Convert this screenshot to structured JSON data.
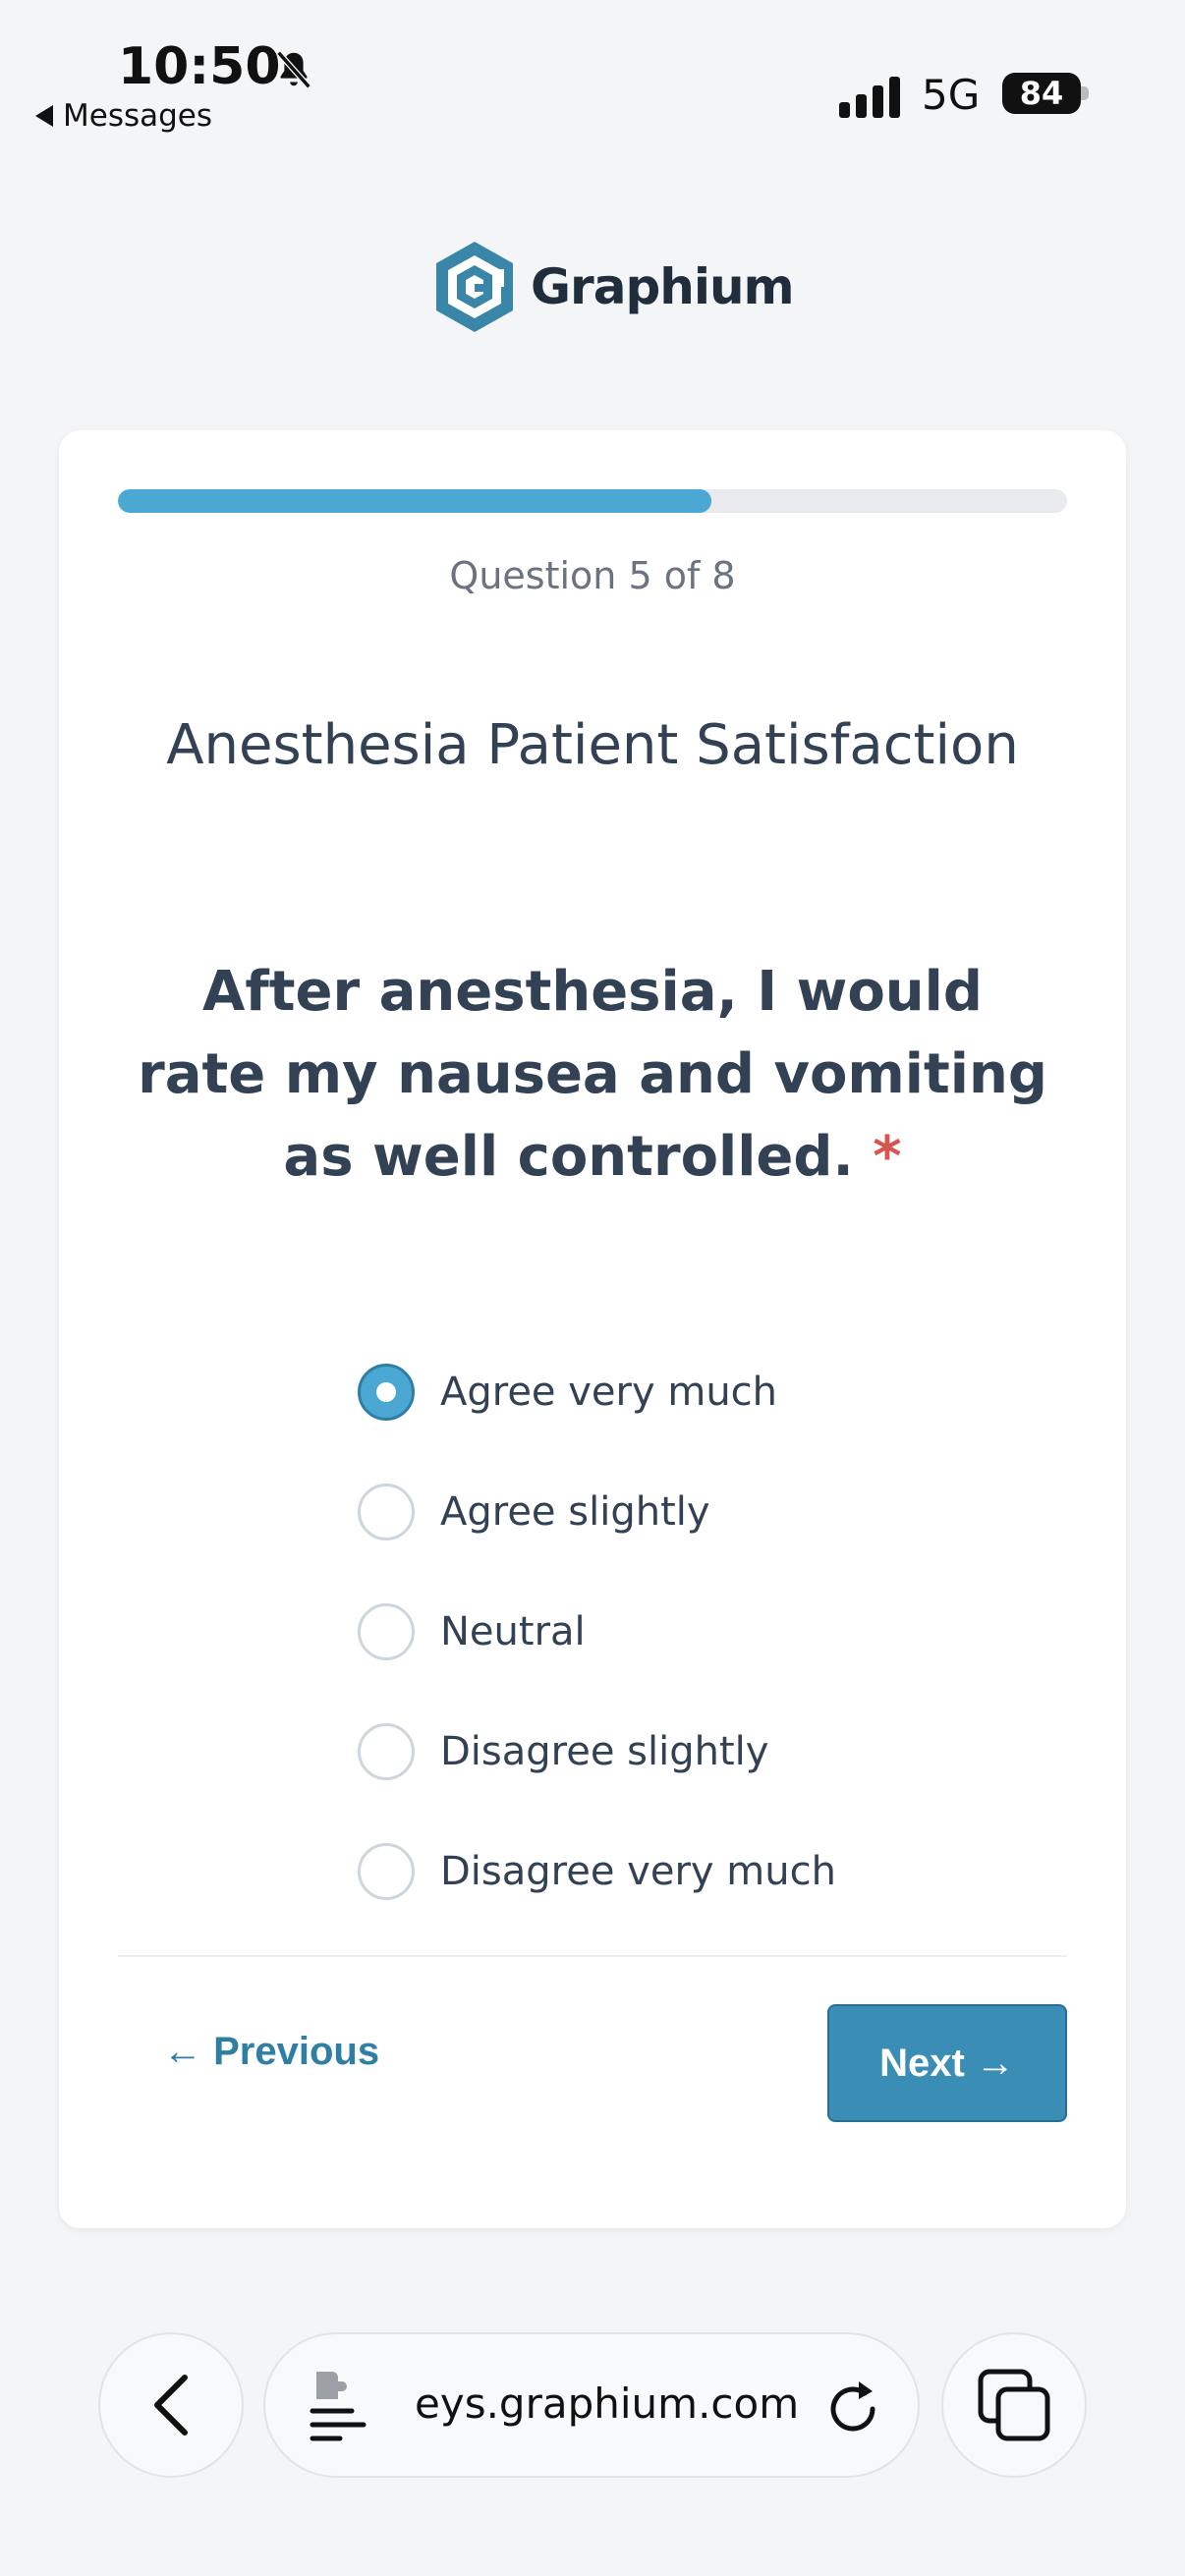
{
  "status_bar": {
    "time": "10:50",
    "back_label": "Messages",
    "network": "5G",
    "battery": "84"
  },
  "logo": {
    "text": "Graphium"
  },
  "progress": {
    "fraction": 0.625
  },
  "survey": {
    "counter": "Question 5 of 8",
    "title": "Anesthesia Patient Satisfaction",
    "question": "After anesthesia, I would rate my nausea and vomiting as well controlled.",
    "required_mark": "*",
    "options": [
      {
        "label": "Agree very much",
        "selected": true
      },
      {
        "label": "Agree slightly",
        "selected": false
      },
      {
        "label": "Neutral",
        "selected": false
      },
      {
        "label": "Disagree slightly",
        "selected": false
      },
      {
        "label": "Disagree very much",
        "selected": false
      }
    ],
    "previous_label": "← Previous",
    "next_label": "Next →"
  },
  "browser": {
    "url": "eys.graphium.com"
  },
  "colors": {
    "accent": "#4aa8d3",
    "button": "#3a8db4",
    "required": "#d9534f"
  }
}
